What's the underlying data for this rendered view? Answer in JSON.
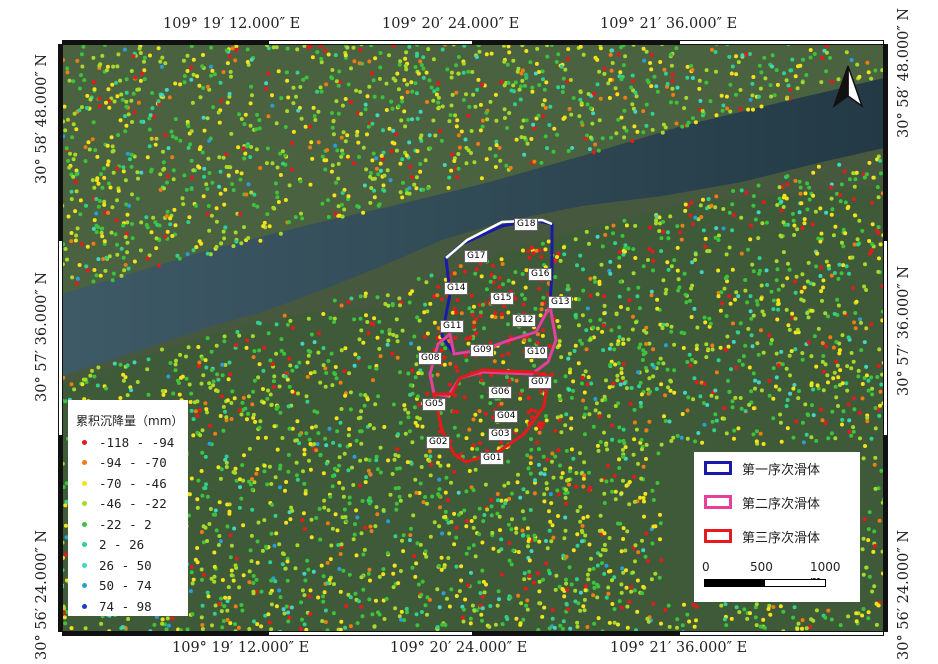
{
  "top_coords": [
    "109° 19′ 12.000″ E",
    "109° 20′ 24.000″ E",
    "109° 21′ 36.000″ E"
  ],
  "bottom_coords": [
    "109° 19′ 12.000″ E",
    "109° 20′ 24.000″ E",
    "109° 21′ 36.000″ E"
  ],
  "left_coords": [
    "30° 58′ 48.000″ N",
    "30° 57′ 36.000″ N",
    "30° 56′ 24.000″ N"
  ],
  "right_coords": [
    "30° 58′ 48.000″ N",
    "30° 57′ 36.000″ N",
    "30° 56′ 24.000″ N"
  ],
  "legend": {
    "title": "累积沉降量（mm）",
    "classes": [
      {
        "label": "-118 - -94",
        "color": "#e41a1c"
      },
      {
        "label": "-94 - -70",
        "color": "#f07c12"
      },
      {
        "label": "-70 - -46",
        "color": "#f5e31a"
      },
      {
        "label": "-46 - -22",
        "color": "#a6d92a"
      },
      {
        "label": "-22 - 2",
        "color": "#3cc23c"
      },
      {
        "label": "2 - 26",
        "color": "#2fd08c"
      },
      {
        "label": "26 - 50",
        "color": "#3fd6c4"
      },
      {
        "label": "50 - 74",
        "color": "#2a9fd6"
      },
      {
        "label": "74 - 98",
        "color": "#1c3fc8"
      }
    ]
  },
  "slide_legend": [
    {
      "label": "第一序次滑体",
      "color": "#1a1aa8"
    },
    {
      "label": "第二序次滑体",
      "color": "#e6409a"
    },
    {
      "label": "第三序次滑体",
      "color": "#e41a1c"
    }
  ],
  "scale": {
    "labels": [
      "0",
      "500",
      "1000 m"
    ]
  },
  "points": [
    "G18",
    "G17",
    "G16",
    "G14",
    "G15",
    "G13",
    "G11",
    "G12",
    "G09",
    "G10",
    "G08",
    "G07",
    "G06",
    "G05",
    "G04",
    "G03",
    "G02",
    "G01"
  ],
  "colors": {
    "river": "#2c4652",
    "vegetation": "#3c6e3a",
    "ground": "#4f5d48"
  }
}
